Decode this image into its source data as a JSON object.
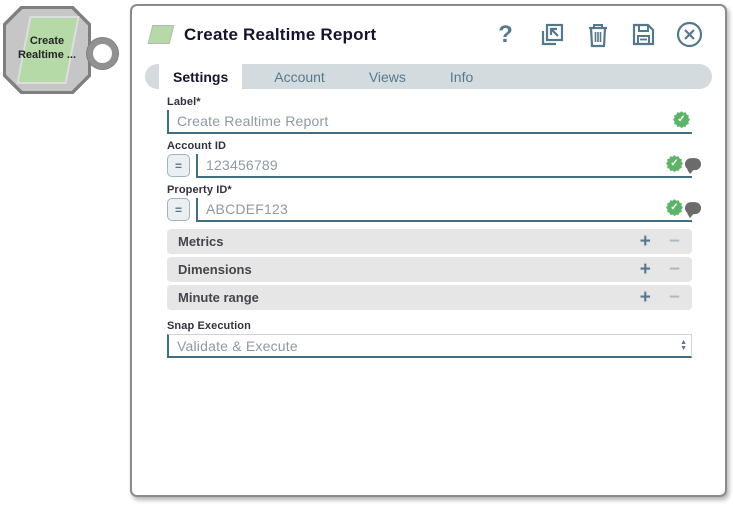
{
  "node": {
    "label_line1": "Create",
    "label_line2": "Realtime ..."
  },
  "dialog": {
    "title": "Create Realtime Report",
    "toolbar": {
      "help": "?"
    },
    "tabs": [
      {
        "label": "Settings",
        "active": true
      },
      {
        "label": "Account",
        "active": false
      },
      {
        "label": "Views",
        "active": false
      },
      {
        "label": "Info",
        "active": false
      }
    ],
    "fields": {
      "label": {
        "label": "Label*",
        "value": "Create Realtime Report"
      },
      "account_id": {
        "label": "Account ID",
        "value": "123456789"
      },
      "property_id": {
        "label": "Property ID*",
        "value": "ABCDEF123"
      }
    },
    "accordions": [
      {
        "label": "Metrics"
      },
      {
        "label": "Dimensions"
      },
      {
        "label": "Minute range"
      }
    ],
    "snap_execution": {
      "label": "Snap Execution",
      "value": "Validate & Execute"
    }
  },
  "icons": {
    "expression_equals": "=",
    "add": "+",
    "remove": "−",
    "spinner_up": "▲",
    "spinner_down": "▼",
    "valid_check": "✓"
  },
  "colors": {
    "icon_blue_gray": "#54798d",
    "input_underline": "#3f6f80",
    "valid_green": "#5cb567",
    "snap_green": "#b5d9a7",
    "tabbar_gray": "#d3dbdf",
    "accordion_gray": "#e6e6e6",
    "dialog_border": "#8b8b8b"
  }
}
